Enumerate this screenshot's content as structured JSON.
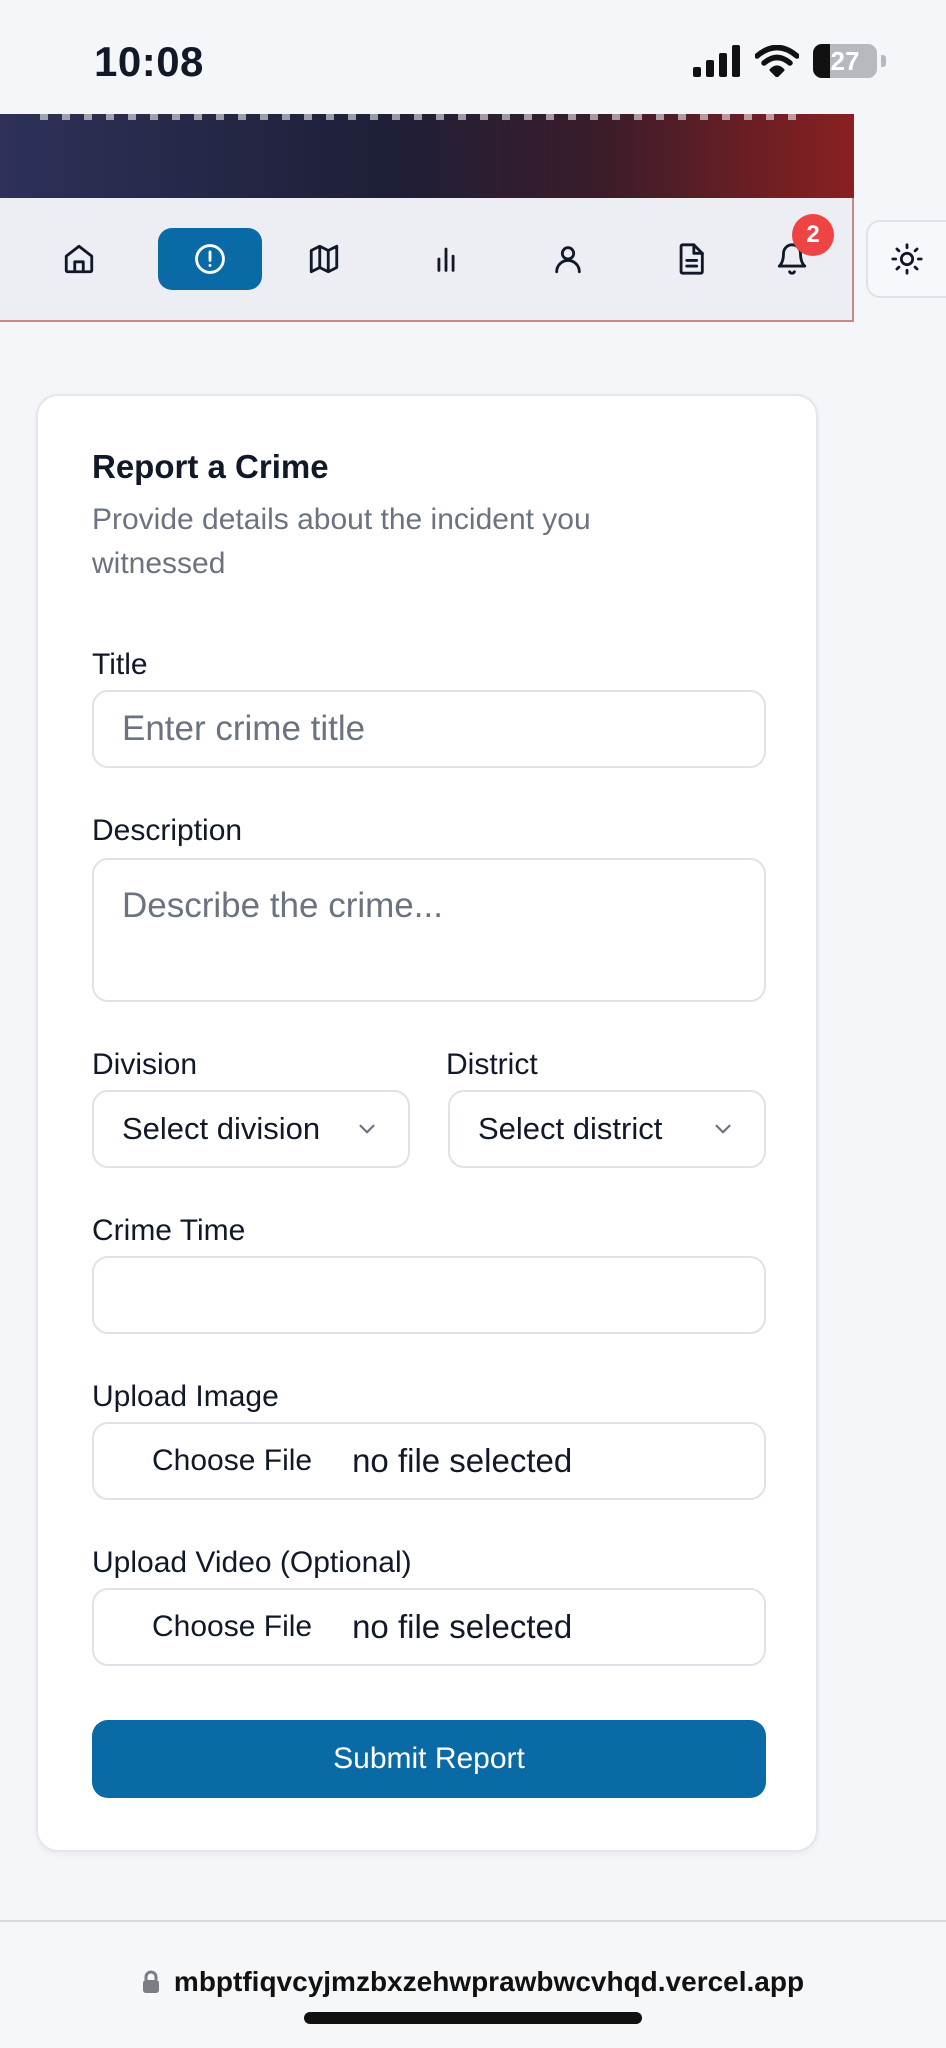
{
  "status_bar": {
    "time": "10:08",
    "battery": "27",
    "icons": [
      "signal-icon",
      "wifi-icon",
      "battery-icon"
    ]
  },
  "nav": {
    "items": [
      {
        "name": "home",
        "icon": "home-icon"
      },
      {
        "name": "report",
        "icon": "alert-circle-icon",
        "active": true
      },
      {
        "name": "map",
        "icon": "map-icon"
      },
      {
        "name": "stats",
        "icon": "bar-chart-icon"
      },
      {
        "name": "profile",
        "icon": "user-icon"
      },
      {
        "name": "documents",
        "icon": "file-text-icon"
      },
      {
        "name": "notifications",
        "icon": "bell-icon",
        "badge": "2"
      }
    ],
    "theme_toggle_icon": "sun-icon",
    "accent": "#0a6aa6",
    "badge_color": "#ef4444"
  },
  "form": {
    "title": "Report a Crime",
    "subtitle": "Provide details about the incident you witnessed",
    "title_label": "Title",
    "title_placeholder": "Enter crime title",
    "description_label": "Description",
    "description_placeholder": "Describe the crime...",
    "division_label": "Division",
    "division_value": "Select division",
    "district_label": "District",
    "district_value": "Select district",
    "crime_time_label": "Crime Time",
    "crime_time_value": "",
    "image_label": "Upload Image",
    "image_button": "Choose File",
    "image_status": "no file selected",
    "video_label": "Upload Video (Optional)",
    "video_button": "Choose File",
    "video_status": "no file selected",
    "submit_label": "Submit Report"
  },
  "browser": {
    "url": "mbptfiqvcyjmzbxzehwprawbwcvhqd.vercel.app",
    "lock_icon": "lock-icon"
  }
}
